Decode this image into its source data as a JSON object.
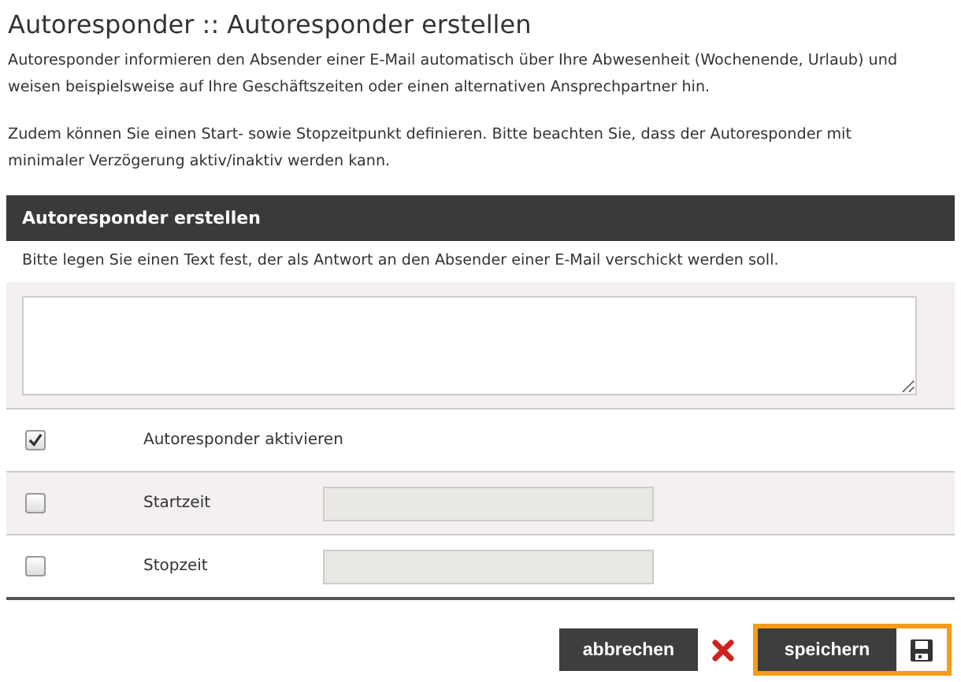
{
  "title": "Autoresponder :: Autoresponder erstellen",
  "paragraphs": [
    "Autoresponder informieren den Absender einer E-Mail automatisch über Ihre Abwesenheit (Wochenende, Urlaub) und weisen beispielsweise auf Ihre Geschäftszeiten oder einen alternativen Ansprechpartner hin.",
    "Zudem können Sie einen Start- sowie Stopzeitpunkt definieren. Bitte beachten Sie, dass der Autoresponder mit minimaler Verzögerung aktiv/inaktiv werden kann."
  ],
  "section": {
    "title": "Autoresponder erstellen",
    "instruction": "Bitte legen Sie einen Text fest, der als Antwort an den Absender einer E-Mail verschickt werden soll.",
    "rows": [
      {
        "kind": "toggle",
        "label": "Autoresponder aktivieren",
        "checked": true
      },
      {
        "kind": "time",
        "label": "Startzeit",
        "checked": false
      },
      {
        "kind": "time",
        "label": "Stopzeit",
        "checked": false
      }
    ]
  },
  "buttons": [
    {
      "kind": "cancel",
      "label": "abbrechen",
      "highlighted": false
    },
    {
      "kind": "save",
      "label": "speichern",
      "highlighted": true
    }
  ]
}
